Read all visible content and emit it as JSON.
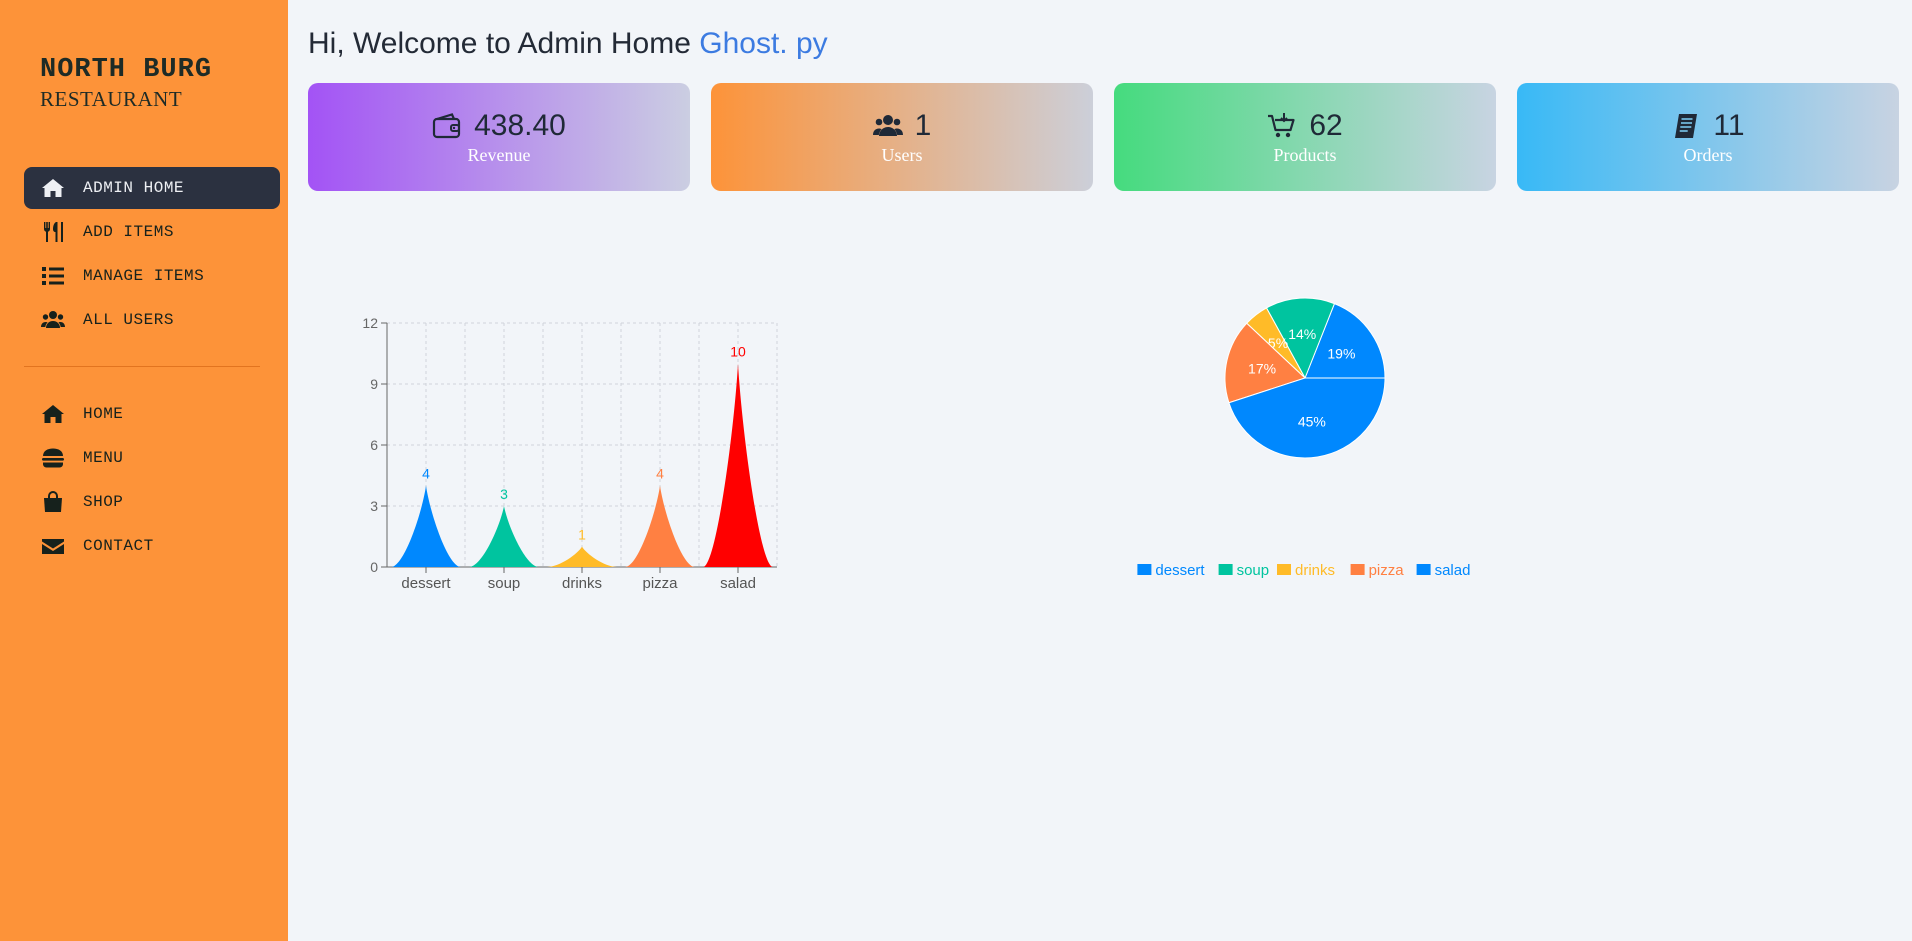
{
  "brand": {
    "name": "NORTH BURG",
    "subtitle": "RESTAURANT"
  },
  "sidebar": {
    "admin_items": [
      {
        "label": "ADMIN HOME",
        "icon": "home-icon",
        "active": true
      },
      {
        "label": "ADD ITEMS",
        "icon": "utensils-icon",
        "active": false
      },
      {
        "label": "MANAGE ITEMS",
        "icon": "list-icon",
        "active": false
      },
      {
        "label": "ALL USERS",
        "icon": "users-icon",
        "active": false
      }
    ],
    "site_items": [
      {
        "label": "HOME",
        "icon": "home-icon"
      },
      {
        "label": "MENU",
        "icon": "burger-icon"
      },
      {
        "label": "SHOP",
        "icon": "shopping-bag-icon"
      },
      {
        "label": "CONTACT",
        "icon": "envelope-icon"
      }
    ]
  },
  "greeting": {
    "text": "Hi, Welcome to Admin Home",
    "name": "Ghost. py"
  },
  "stats": {
    "revenue": {
      "value": "438.40",
      "label": "Revenue",
      "icon": "wallet-icon"
    },
    "users": {
      "value": "1",
      "label": "Users",
      "icon": "users-icon"
    },
    "products": {
      "value": "62",
      "label": "Products",
      "icon": "cart-icon"
    },
    "orders": {
      "value": "11",
      "label": "Orders",
      "icon": "receipt-icon"
    }
  },
  "chart_data": [
    {
      "type": "bar",
      "categories": [
        "dessert",
        "soup",
        "drinks",
        "pizza",
        "salad"
      ],
      "values": [
        4,
        3,
        1,
        4,
        10
      ],
      "colors": [
        "#0088FE",
        "#00C49F",
        "#FFBB28",
        "#FF8042",
        "#FF0000"
      ],
      "yticks": [
        0,
        3,
        6,
        9,
        12
      ],
      "ylim": [
        0,
        12
      ],
      "grid": true
    },
    {
      "type": "pie",
      "labels": [
        "dessert",
        "soup",
        "drinks",
        "pizza",
        "salad"
      ],
      "values": [
        19,
        14,
        5,
        17,
        45
      ],
      "percent_labels": [
        "19%",
        "14%",
        "5%",
        "17%",
        "45%"
      ],
      "colors": [
        "#0088FE",
        "#00C49F",
        "#FFBB28",
        "#FF8042",
        "#0088FE"
      ],
      "legend": "bottom"
    }
  ]
}
